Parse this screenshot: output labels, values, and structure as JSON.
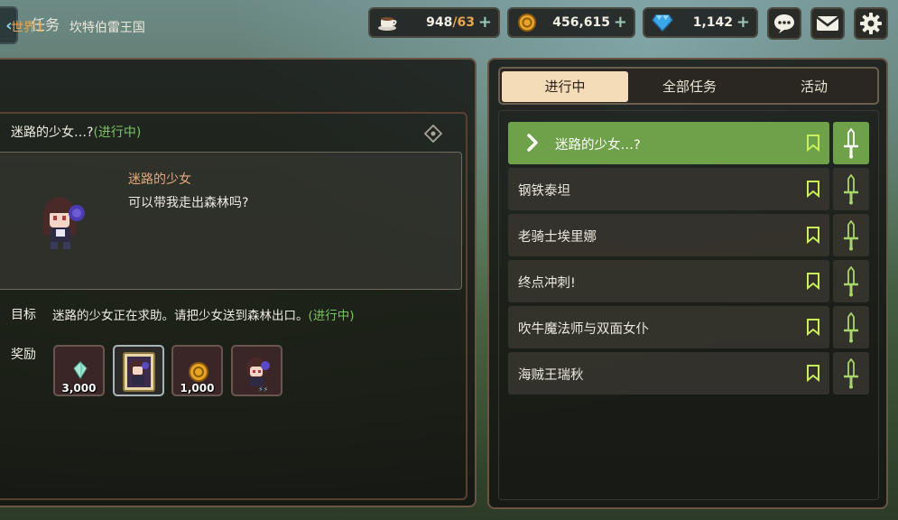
{
  "header": {
    "title": "任务",
    "stamina": {
      "current": "948",
      "max": "/63"
    },
    "gold": "456,615",
    "gems": "1,142"
  },
  "world": {
    "tag": "世界1",
    "name": "坎特伯雷王国"
  },
  "quest": {
    "title": "迷路的少女…?",
    "status": "(进行中)",
    "npc_name": "迷路的少女",
    "npc_line": "可以带我走出森林吗?",
    "goal_label": "目标",
    "goal_text": "迷路的少女正在求助。请把少女送到森林出口。",
    "goal_status": "(进行中)",
    "reward_label": "奖励",
    "rewards": [
      {
        "icon": "crystal-icon",
        "amount": "3,000"
      },
      {
        "icon": "hero-card-icon",
        "amount": ""
      },
      {
        "icon": "gold-coin-icon",
        "amount": "1,000"
      },
      {
        "icon": "costume-icon",
        "amount": ""
      }
    ]
  },
  "tabs": [
    "进行中",
    "全部任务",
    "活动"
  ],
  "quest_list": [
    "迷路的少女…?",
    "钢铁泰坦",
    "老骑士埃里娜",
    "终点冲刺!",
    "吹牛魔法师与双面女仆",
    "海贼王瑞秋"
  ],
  "colors": {
    "accent_green": "#6fa04a",
    "status_green": "#79c45e",
    "tab_active": "#f4dcb8",
    "frame": "#6b5444"
  }
}
